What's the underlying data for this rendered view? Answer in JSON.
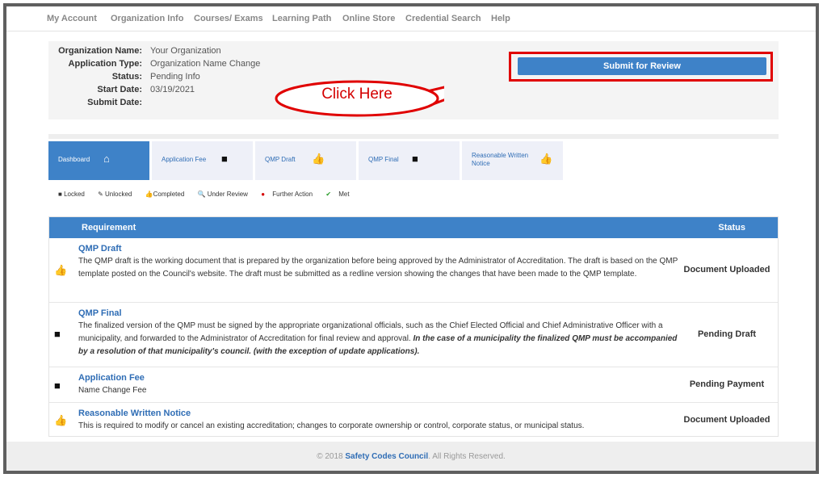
{
  "nav": {
    "items": [
      "My Account",
      "Organization Info",
      "Courses/ Exams",
      "Learning Path",
      "Online Store",
      "Credential Search",
      "Help"
    ]
  },
  "summary": {
    "labels": [
      "Organization Name:",
      "Application Type:",
      "Status:",
      "Start Date:",
      "Submit Date:"
    ],
    "values": [
      "Your Organization",
      "Organization Name Change",
      "Pending Info",
      "03/19/2021",
      ""
    ]
  },
  "submit": {
    "label": "Submit for Review"
  },
  "callout": {
    "text": "Click Here"
  },
  "tabs": [
    {
      "label": "Dashboard",
      "icon": "home-icon"
    },
    {
      "label": "Application Fee",
      "icon": "lock-icon"
    },
    {
      "label": "QMP Draft",
      "icon": "thumbs-up-icon"
    },
    {
      "label": "QMP Final",
      "icon": "lock-icon"
    },
    {
      "label_line1": "Reasonable Written",
      "label_line2": "Notice",
      "icon": "thumbs-up-icon"
    }
  ],
  "legend": {
    "locked": "Locked",
    "unlocked": "Unlocked",
    "completed": "Completed",
    "under_review": "Under Review",
    "further_action": "Further Action",
    "met": "Met"
  },
  "table": {
    "header_requirement": "Requirement",
    "header_status": "Status",
    "rows": [
      {
        "icon": "thumbs-up-icon",
        "title": "QMP Draft",
        "desc": "The QMP draft is the working document that is prepared by the organization before being approved by the Administrator of Accreditation. The draft is based on the QMP template posted on the Council's website. The draft must be submitted as a redline version showing the changes that have been made to the QMP template.",
        "status": "Document Uploaded"
      },
      {
        "icon": "lock-icon",
        "title": "QMP Final",
        "desc": "The finalized version of the QMP must be signed by the appropriate organizational officials, such as the Chief Elected Official and Chief Administrative Officer with a municipality, and forwarded to the Administrator of Accreditation for final review and approval.",
        "desc_emph": "In the case of a municipality the finalized QMP must be accompanied by a resolution of that municipality's council. (with the exception of update applications).",
        "status": "Pending Draft"
      },
      {
        "icon": "lock-icon",
        "title": "Application Fee",
        "desc": "Name Change Fee",
        "status": "Pending Payment"
      },
      {
        "icon": "thumbs-up-icon",
        "title": "Reasonable Written Notice",
        "desc": "This is required to modify or cancel an existing accreditation; changes to corporate ownership or control, corporate status, or municipal status.",
        "status": "Document Uploaded"
      }
    ]
  },
  "footer": {
    "prefix": "© 2018",
    "org": "Safety Codes Council",
    "suffix": ". All Rights Reserved."
  },
  "colors": {
    "primary": "#3e82c8",
    "callout_red": "#d40000",
    "border_red": "#e00000"
  }
}
